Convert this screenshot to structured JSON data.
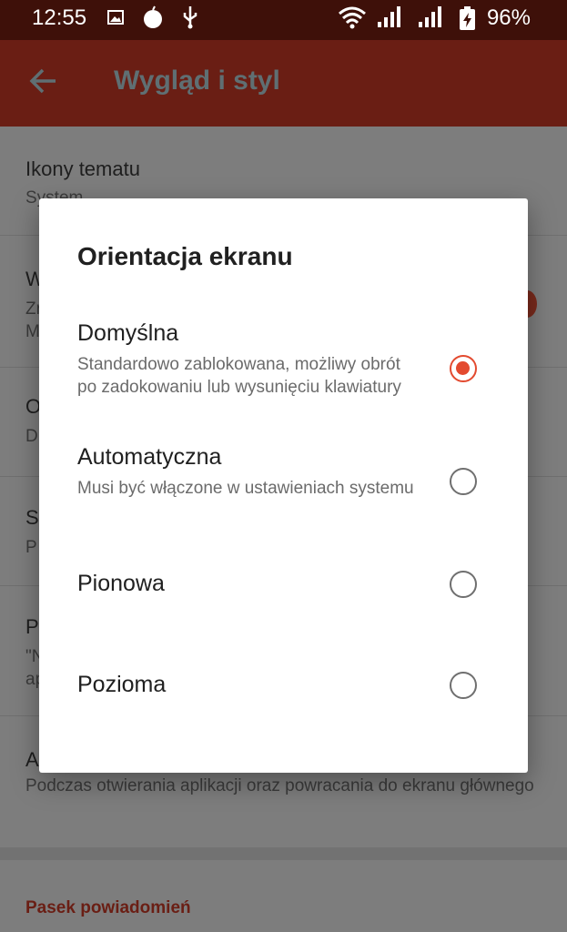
{
  "status": {
    "time": "12:55",
    "battery": "96%"
  },
  "appbar": {
    "title": "Wygląd i styl"
  },
  "list": {
    "items": [
      {
        "title": "Ikony tematu",
        "summary": "System"
      },
      {
        "title": "W",
        "summary": "Zr\nM"
      },
      {
        "title": "O",
        "summary": "D"
      },
      {
        "title": "S",
        "summary": "P"
      },
      {
        "title": "P",
        "summary": "\"N\nap"
      },
      {
        "title": "A",
        "summary": "Podczas otwierania aplikacji oraz powracania do ekranu głównego"
      }
    ],
    "category": "Pasek powiadomień"
  },
  "dialog": {
    "title": "Orientacja ekranu",
    "options": [
      {
        "label": "Domyślna",
        "desc": "Standardowo zablokowana, możliwy obrót po zadokowaniu lub wysunięciu klawiatury",
        "selected": true
      },
      {
        "label": "Automatyczna",
        "desc": "Musi być włączone w ustawieniach systemu",
        "selected": false
      },
      {
        "label": "Pionowa",
        "desc": "",
        "selected": false
      },
      {
        "label": "Pozioma",
        "desc": "",
        "selected": false
      }
    ]
  },
  "colors": {
    "accent": "#e34a2f",
    "appbar": "#6a1e14",
    "statusbar": "#3e1009"
  }
}
